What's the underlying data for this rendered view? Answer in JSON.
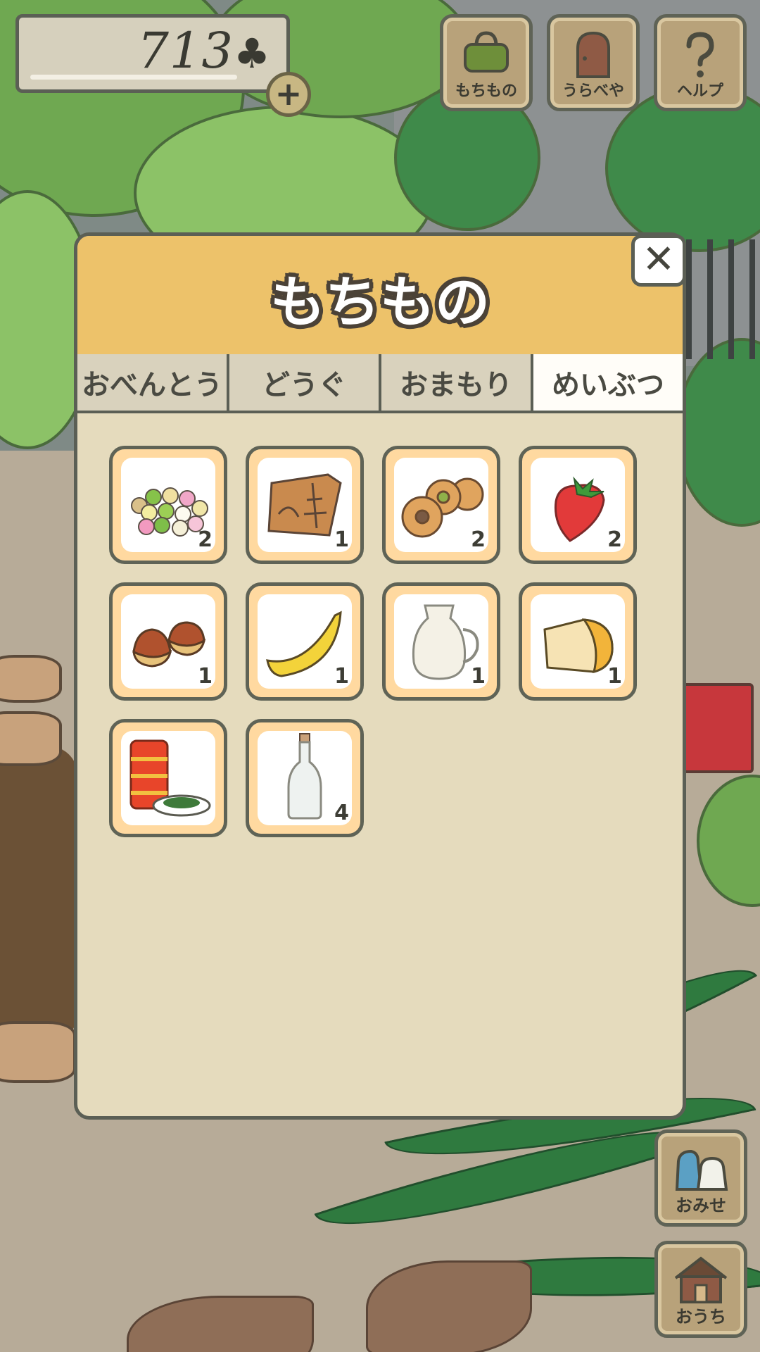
{
  "currency": {
    "amount": "713",
    "symbol": "♣",
    "add_label": "+"
  },
  "top_buttons": [
    {
      "label": "もちもの",
      "icon": "bag-icon"
    },
    {
      "label": "うらべや",
      "icon": "door-icon"
    },
    {
      "label": "ヘルプ",
      "icon": "question-icon"
    }
  ],
  "side_buttons": [
    {
      "label": "おみせ",
      "icon": "shop-bags-icon"
    },
    {
      "label": "おうち",
      "icon": "house-icon"
    }
  ],
  "panel": {
    "title": "もちもの",
    "close_label": "✕",
    "tabs": [
      {
        "label": "おべんとう",
        "active": false
      },
      {
        "label": "どうぐ",
        "active": false
      },
      {
        "label": "おまもり",
        "active": false
      },
      {
        "label": "めいぶつ",
        "active": true
      }
    ],
    "items": [
      {
        "icon": "dango-icon",
        "count": "2"
      },
      {
        "icon": "map-wrapper-icon",
        "count": "1"
      },
      {
        "icon": "buns-icon",
        "count": "2"
      },
      {
        "icon": "strawberry-icon",
        "count": "2"
      },
      {
        "icon": "chestnut-icon",
        "count": "1"
      },
      {
        "icon": "banana-icon",
        "count": "1"
      },
      {
        "icon": "milk-jug-icon",
        "count": "1"
      },
      {
        "icon": "cheese-icon",
        "count": "1"
      },
      {
        "icon": "tea-tin-icon",
        "count": ""
      },
      {
        "icon": "bottle-icon",
        "count": "4"
      }
    ]
  },
  "colors": {
    "panel_bg": "#e5dbbd",
    "header": "#edc26a",
    "slot_border": "#ffd9a0",
    "outline": "#5b5f55"
  }
}
